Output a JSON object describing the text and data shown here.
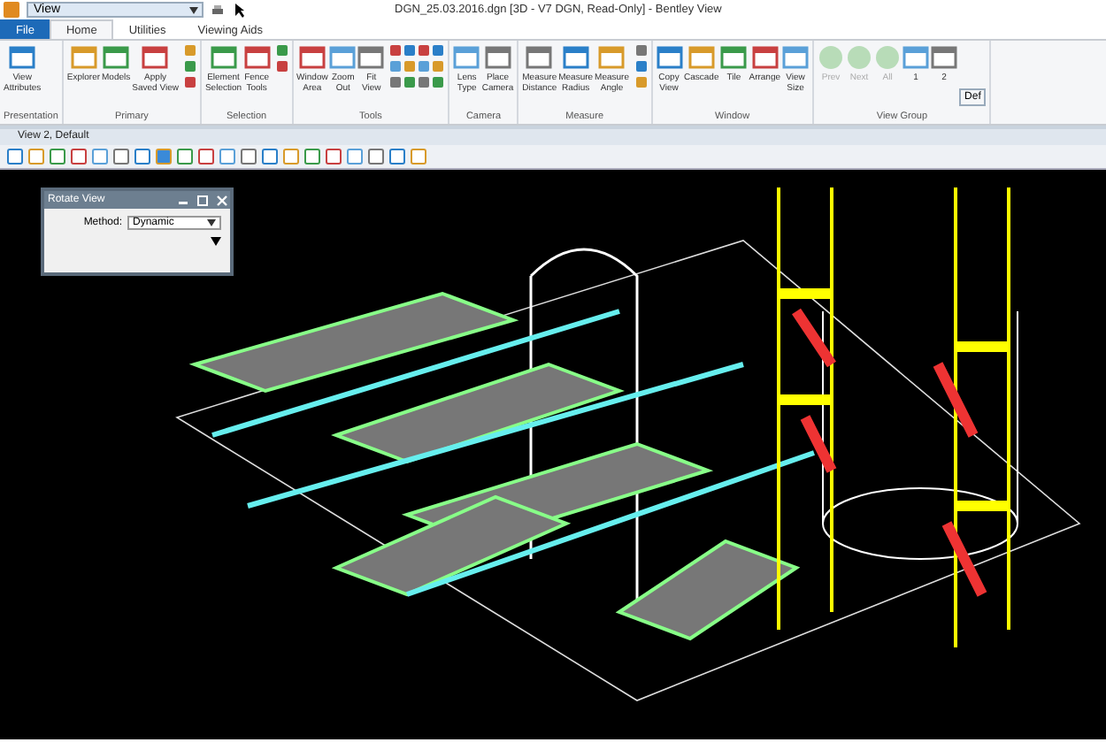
{
  "quick_access": {
    "dropdown_value": "View"
  },
  "window": {
    "title": "DGN_25.03.2016.dgn [3D - V7 DGN, Read-Only] - Bentley View"
  },
  "tabs": [
    {
      "label": "File",
      "kind": "file",
      "selected": false
    },
    {
      "label": "Home",
      "kind": "tab",
      "selected": true
    },
    {
      "label": "Utilities",
      "kind": "tab",
      "selected": false
    },
    {
      "label": "Viewing Aids",
      "kind": "tab",
      "selected": false
    }
  ],
  "ribbon_groups": [
    {
      "label": "Presentation",
      "buttons": [
        {
          "label": "View\nAttributes",
          "disabled": false
        }
      ]
    },
    {
      "label": "Primary",
      "buttons": [
        {
          "label": "Explorer",
          "disabled": false
        },
        {
          "label": "Models",
          "disabled": false
        },
        {
          "label": "Apply\nSaved View",
          "disabled": false
        }
      ]
    },
    {
      "label": "Selection",
      "buttons": [
        {
          "label": "Element\nSelection",
          "disabled": false
        },
        {
          "label": "Fence\nTools",
          "disabled": false
        }
      ]
    },
    {
      "label": "Tools",
      "buttons": [
        {
          "label": "Window\nArea",
          "disabled": false
        },
        {
          "label": "Zoom\nOut",
          "disabled": false
        },
        {
          "label": "Fit\nView",
          "disabled": false
        }
      ]
    },
    {
      "label": "Camera",
      "buttons": [
        {
          "label": "Lens\nType",
          "disabled": false
        },
        {
          "label": "Place\nCamera",
          "disabled": false
        }
      ]
    },
    {
      "label": "Measure",
      "buttons": [
        {
          "label": "Measure\nDistance",
          "disabled": false
        },
        {
          "label": "Measure\nRadius",
          "disabled": false
        },
        {
          "label": "Measure\nAngle",
          "disabled": false
        }
      ]
    },
    {
      "label": "Window",
      "buttons": [
        {
          "label": "Copy\nView",
          "disabled": false
        },
        {
          "label": "Cascade",
          "disabled": false
        },
        {
          "label": "Tile",
          "disabled": false
        },
        {
          "label": "Arrange",
          "disabled": false
        },
        {
          "label": "View\nSize",
          "disabled": false
        }
      ]
    },
    {
      "label": "View Group",
      "buttons": [
        {
          "label": "Prev",
          "disabled": true
        },
        {
          "label": "Next",
          "disabled": true
        },
        {
          "label": "All",
          "disabled": true
        },
        {
          "label": "1",
          "disabled": false
        },
        {
          "label": "2",
          "disabled": false
        }
      ]
    }
  ],
  "view_group_default": "Def",
  "view": {
    "title": "View 2, Default"
  },
  "dialog": {
    "title": "Rotate View",
    "field_label": "Method:",
    "field_value": "Dynamic"
  }
}
